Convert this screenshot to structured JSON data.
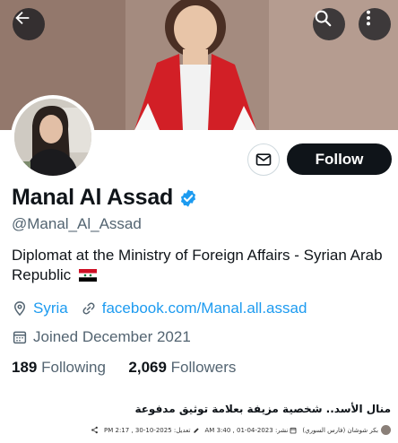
{
  "profile": {
    "display_name": "Manal Al Assad",
    "handle": "@Manal_Al_Assad",
    "bio": "Diplomat at the Ministry of Foreign  Affairs - Syrian Arab Republic",
    "location": "Syria",
    "website": "facebook.com/Manal.all.assad",
    "joined": "Joined December 2021",
    "following_count": "189",
    "following_label": "Following",
    "followers_count": "2,069",
    "followers_label": "Followers",
    "verified": true
  },
  "actions": {
    "follow_label": "Follow"
  },
  "article": {
    "title": "منال الأسد.. شخصية مزيفة بعلامة توثيق مدفوعة",
    "author": "بكر شوشان (فارس السوري)",
    "published": "نشر: 2023-04-01 , 3:40 AM",
    "edited": "تعديل: 2025-10-30 , 2:17 PM"
  },
  "icons": {
    "back": "arrow-left-icon",
    "search": "search-icon",
    "more": "more-vertical-icon",
    "message": "envelope-icon",
    "verified": "verified-badge-icon",
    "location": "location-pin-icon",
    "link": "link-icon",
    "calendar": "calendar-icon",
    "share": "share-icon",
    "edit": "pencil-icon"
  },
  "colors": {
    "accent": "#1d9bf0",
    "text": "#0f1419",
    "secondary": "#536471",
    "follow_bg": "#0f1419"
  }
}
